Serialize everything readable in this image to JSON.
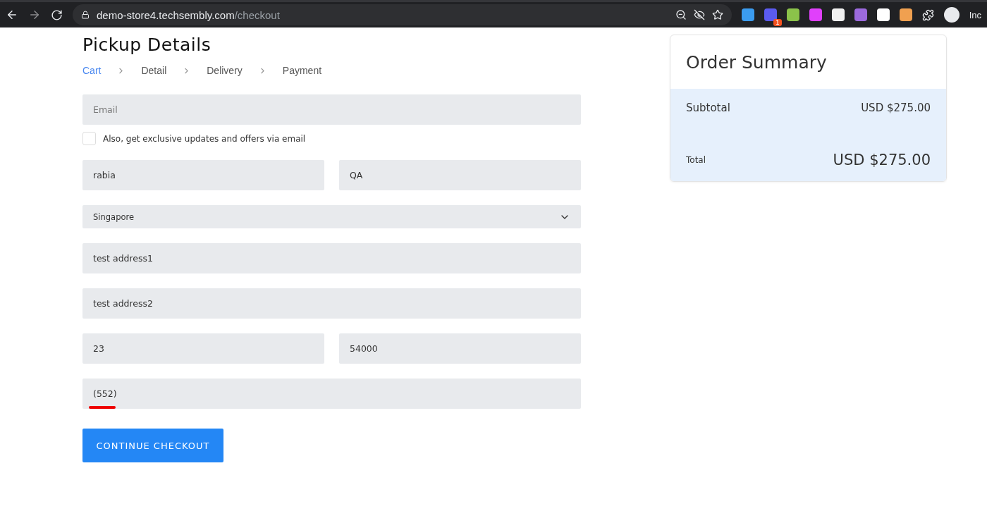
{
  "browser": {
    "url_host": "demo-store4.techsembly.com",
    "url_path": "/checkout",
    "extension_badge": "1",
    "profile_label": "Inc"
  },
  "page": {
    "title": "Pickup Details",
    "breadcrumb": [
      {
        "label": "Cart",
        "selected": true
      },
      {
        "label": "Detail",
        "selected": false
      },
      {
        "label": "Delivery",
        "selected": false
      },
      {
        "label": "Payment",
        "selected": false
      }
    ],
    "email": {
      "placeholder": "Email"
    },
    "newsletter": {
      "label": "Also, get exclusive updates and offers via email",
      "checked": false
    },
    "rows": [
      {
        "fields": [
          {
            "kind": "input",
            "value": "rabia"
          },
          {
            "kind": "input",
            "value": "QA"
          }
        ]
      },
      {
        "fields": [
          {
            "kind": "select",
            "value": "Singapore"
          }
        ]
      },
      {
        "fields": [
          {
            "kind": "input",
            "value": "test address1"
          }
        ]
      },
      {
        "fields": [
          {
            "kind": "input",
            "value": "test address2"
          }
        ]
      },
      {
        "fields": [
          {
            "kind": "input",
            "value": "23"
          },
          {
            "kind": "input",
            "value": "54000"
          }
        ]
      },
      {
        "fields": [
          {
            "kind": "input",
            "value": "(552)",
            "underlined": true
          }
        ]
      }
    ],
    "submit": "CONTINUE CHECKOUT"
  },
  "summary": {
    "title": "Order Summary",
    "subtotal_label": "Subtotal",
    "subtotal": "USD $275.00",
    "total_label": "Total",
    "total": "USD $275.00"
  }
}
